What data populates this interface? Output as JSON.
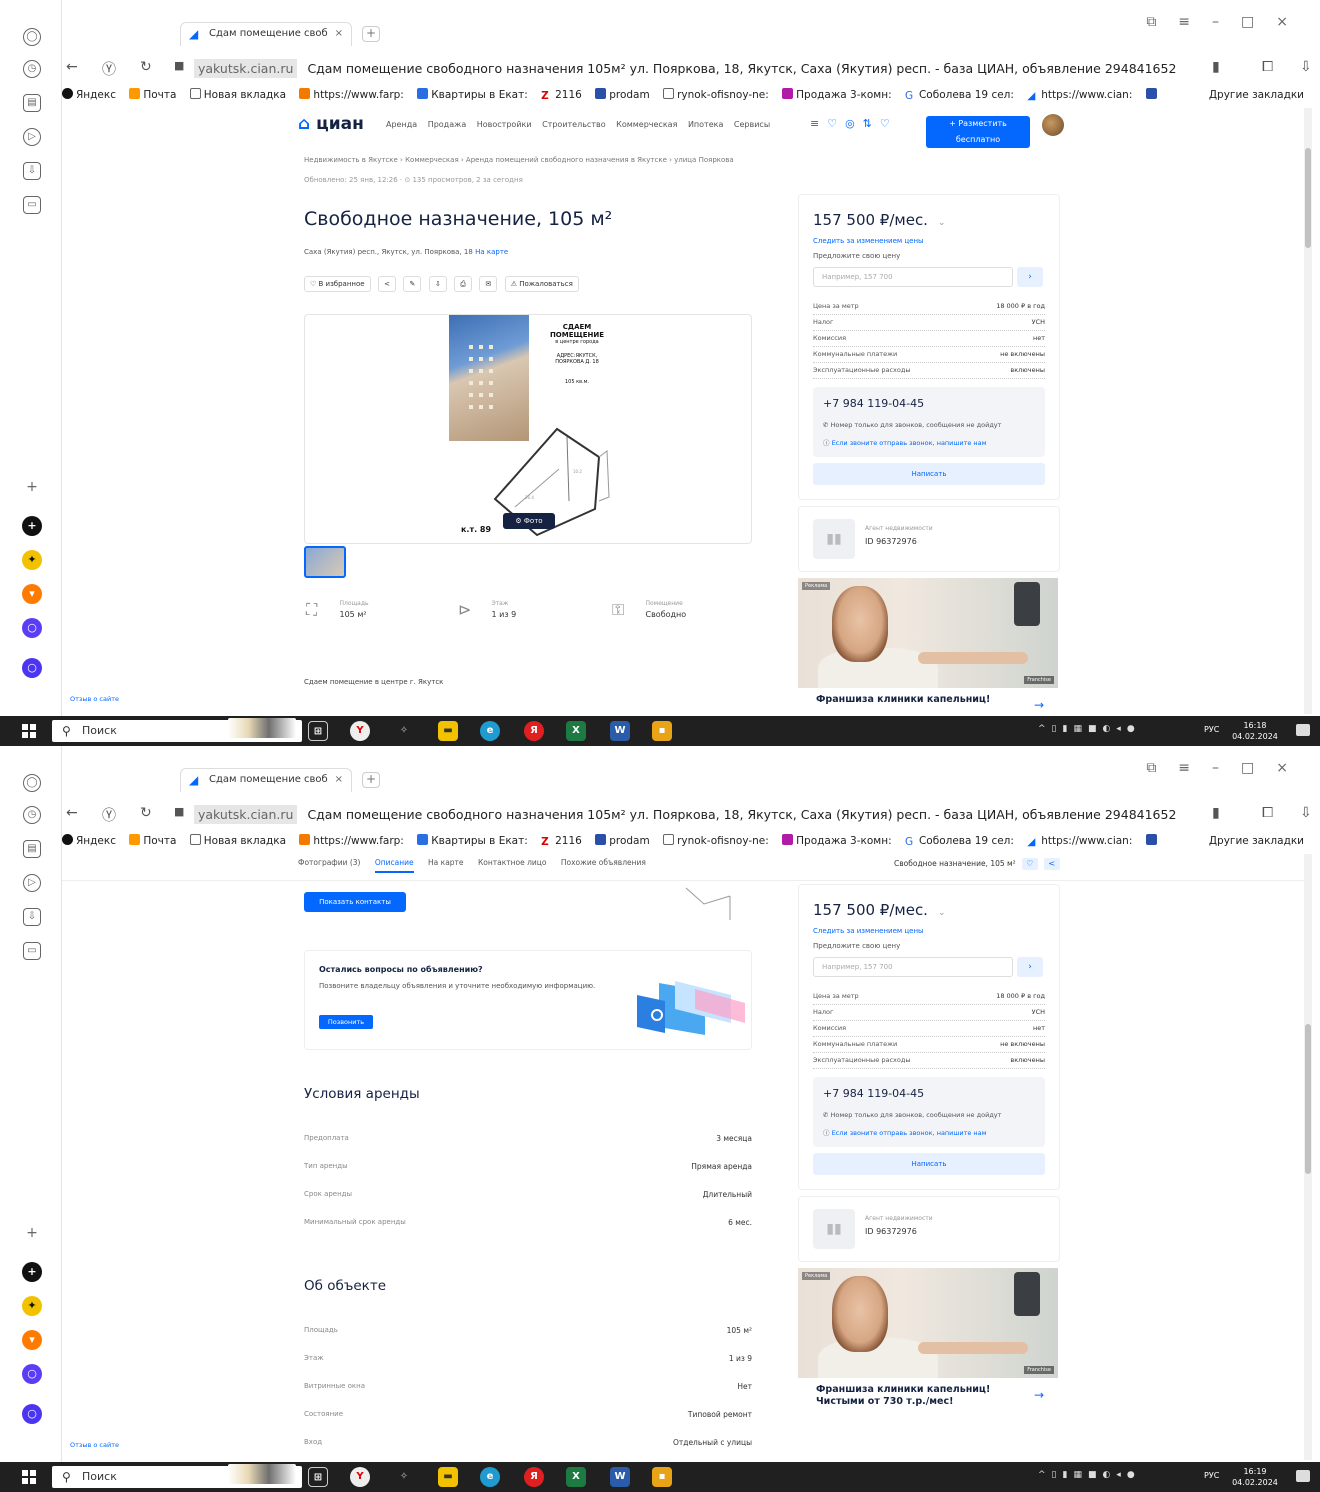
{
  "browser": {
    "tab_title": "Сдам помещение своб",
    "tab_close": "×",
    "new_tab": "+",
    "address_host": "yakutsk.cian.ru",
    "address_title": "Сдам помещение свободного назначения 105м² ул. Поярковa, 18, Якутск, Саха (Якутия) респ. - база ЦИАН, объявление 294841652",
    "bookmarks": [
      "Яндекс",
      "Почта",
      "Новая вкладка",
      "https://www.farp:",
      "Квартиры в Екат:",
      "2116",
      "prodam",
      "rynok-ofisnoy-ne:",
      "Продажа 3-комн:",
      "Соболева 19 сел:",
      "https://www.cian:"
    ],
    "bookmarks_other": "Другие закладки"
  },
  "colors": {
    "accent": "#0468ff",
    "text": "#152242",
    "taskbar": "#202020"
  },
  "icons": [
    "back-icon",
    "reload-icon",
    "lock-icon",
    "bookmark-icon",
    "download-icon",
    "home-icon",
    "start-icon",
    "search-icon"
  ],
  "cian": {
    "logo": "циан",
    "nav": [
      "Аренда",
      "Продажа",
      "Новостройки",
      "Строительство",
      "Коммерческая",
      "Ипотека",
      "Сервисы"
    ],
    "publish": "+ Разместить бесплатно"
  },
  "listing": {
    "title": "Свободное назначение, 105 м²",
    "address": "Саха (Якутия) респ., Якутск, ул. Поярковa, 18",
    "map_link": "На карте",
    "actions": [
      "♡ В избранное",
      "<",
      "✎",
      "⇩",
      "⎙",
      "✉",
      "⚠ Пожаловаться"
    ],
    "flyer": {
      "l1": "СДАЕМ",
      "l2": "ПОМЕЩЕНИЕ",
      "l3": "в центре города",
      "l4": "АДРЕС:ЯКУТСК,",
      "l5": "ПОЯРКОВА Д. 18",
      "l6": "105 кв.м."
    },
    "photo_badge": "⚙ Фото",
    "photo_label": "к.т. 89",
    "features": [
      {
        "t": "Площадь",
        "v": "105 м²"
      },
      {
        "t": "Этаж",
        "v": "1 из 9"
      },
      {
        "t": "Помещение",
        "v": "Свободно"
      }
    ],
    "description": "Сдаем помещение в центре г. Якутск",
    "show_contacts": "Показать контакты"
  },
  "price_card": {
    "price": "157 500 ₽/мес.",
    "watch": "Следить за изменением цены",
    "offer": "Предложите свою цену",
    "offer_placeholder": "Например, 157 700",
    "rows": [
      {
        "k": "Цена за метр",
        "v": "18 000 ₽ в год"
      },
      {
        "k": "Налог",
        "v": "УСН"
      },
      {
        "k": "Комиссия",
        "v": "нет"
      },
      {
        "k": "Коммунальные платежи",
        "v": "не включены"
      },
      {
        "k": "Эксплуатационные расходы",
        "v": "включены"
      }
    ],
    "phone": "+7 984 119-04-45",
    "phone_note1": "Номер только для звонков, сообщения не дойдут",
    "phone_note2": "Если звоните отправь звонок, напишите нам",
    "write": "Написать"
  },
  "agent": {
    "title": "Агент недвижимости",
    "id": "ID 96372976"
  },
  "ad": {
    "title": "Франшиза клиники капельниц! Чистыми от 730 т.р./мес!",
    "tag": "Реклама",
    "tag2": "Franchise"
  },
  "feedback": "Отзыв о сайте",
  "subnav": {
    "items": [
      "Фотографии (3)",
      "Описание",
      "На карте",
      "Контактное лицо",
      "Похожие объявления"
    ],
    "right": "Свободное назначение, 105 м²"
  },
  "question": {
    "title": "Остались вопросы по объявлению?",
    "text": "Позвоните владельцу объявления и уточните необходимую информацию.",
    "button": "Позвонить"
  },
  "rent_terms": {
    "title": "Условия аренды",
    "rows": [
      {
        "k": "Предоплата",
        "v": "3 месяца"
      },
      {
        "k": "Тип аренды",
        "v": "Прямая аренда"
      },
      {
        "k": "Срок аренды",
        "v": "Длительный"
      },
      {
        "k": "Минимальный срок аренды",
        "v": "6 мес."
      }
    ]
  },
  "about": {
    "title": "Об объекте",
    "rows": [
      {
        "k": "Площадь",
        "v": "105 м²"
      },
      {
        "k": "Этаж",
        "v": "1 из 9"
      },
      {
        "k": "Витринные окна",
        "v": "Нет"
      },
      {
        "k": "Состояние",
        "v": "Типовой ремонт"
      },
      {
        "k": "Вход",
        "v": "Отдельный с улицы"
      }
    ]
  },
  "taskbar": {
    "search": "Поиск",
    "lang": "РУС",
    "time1": "16:18",
    "time2": "16:19",
    "date": "04.02.2024"
  }
}
